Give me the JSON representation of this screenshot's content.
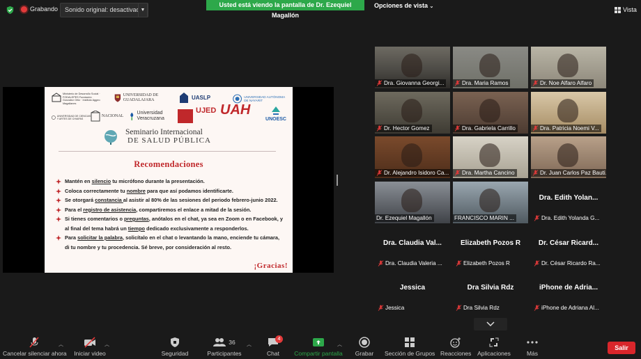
{
  "topbar": {
    "recording_label": "Grabando",
    "sound_option": "Sonido original: desactivado",
    "viewing_banner": "Usted está viendo la pantalla de Dr. Ezequiel Magallón",
    "view_options": "Opciones de vista",
    "view_label": "Vista"
  },
  "slide": {
    "logos": {
      "l1": "Ministerio de Desarrollo Social · FODALEPES Fundación Gonzalez Ortiz · Instituto Aggeo Magallanes",
      "l2": "UNIVERSIDAD DE GUADALAJARA",
      "l3": "UASLP",
      "l4": "UNIVERSIDAD AUTÓNOMA DE NAYARIT",
      "l5": "UNIVERSIDAD DE CIENCIAS Y ARTES DE CHIAPAS",
      "l6": "NACIONAL",
      "l7": "Universidad Veracruzana",
      "l8": "UJED",
      "l9": "UAH",
      "l10": "UNOESC"
    },
    "seminar_line1": "Seminario Internacional",
    "seminar_line2": "DE SALUD PÚBLICA",
    "heading": "Recomendaciones",
    "thanks": "¡Gracias!",
    "bullets": [
      {
        "a": "Mantén en ",
        "u": "silencio",
        "b": " tu micrófono durante la presentación."
      },
      {
        "a": "Coloca correctamente tu ",
        "u": "nombre",
        "b": " para que así podamos identificarte."
      },
      {
        "a": "Se otorgará ",
        "u": "constancia ",
        "b": "al asistir al 80% de las sesiones del periodo febrero-junio 2022."
      },
      {
        "a": "Para el ",
        "u": "registro de asistencia",
        "b": ", compartiremos el enlace a mitad de la sesión."
      },
      {
        "a": "Si tienes comentarios o ",
        "u": "preguntas",
        "b": ", anótalos en el chat, ya sea en Zoom o en Facebook, y al final del tema habrá un ",
        "u2": "tiempo",
        "c": " dedicado exclusivamente a responderlos."
      },
      {
        "a": "Para ",
        "u": "solicitar la palabra",
        "b": ", solicítalo en el chat o levantando la mano, enciende tu cámara, di tu nombre y tu procedencia. Sé breve, por consideración al resto."
      }
    ]
  },
  "participants": [
    {
      "name": "Dra. Giovanna Georgi..."
    },
    {
      "name": "Dra. Maria Ramos"
    },
    {
      "name": "Dr. Noe Alfaro Alfaro"
    },
    {
      "name": "Dr. Hector Gomez"
    },
    {
      "name": "Dra. Gabriela Carrillo"
    },
    {
      "name": "Dra. Patricia Noemi V..."
    },
    {
      "name": "Dr. Alejandro Isidoro Ca..."
    },
    {
      "name": "Dra. Martha Cancino"
    },
    {
      "name": "Dr. Juan Carlos Paz Bauti..."
    },
    {
      "name": "Dr. Ezequiel Magallón"
    },
    {
      "name": "FRANCISCO MARIN ..."
    },
    {
      "name": "Dra. Edith Yolanda G...",
      "big": "Dra. Edith Yolan..."
    },
    {
      "name": "Dra. Claudia Valeria ...",
      "big": "Dra. Claudia Val..."
    },
    {
      "name": "Elizabeth Pozos R",
      "big": "Elizabeth Pozos R"
    },
    {
      "name": "Dr. César Ricardo Ra...",
      "big": "Dr. César Ricard..."
    },
    {
      "name": "Jessica",
      "big": "Jessica"
    },
    {
      "name": "Dra Silvia Rdz",
      "big": "Dra Silvia Rdz"
    },
    {
      "name": "iPhone de Adriana Al...",
      "big": "iPhone de Adria..."
    }
  ],
  "toolbar": {
    "mute": "Cancelar silenciar ahora",
    "video": "Iniciar video",
    "security": "Seguridad",
    "participants": "Participantes",
    "participants_count": "36",
    "chat": "Chat",
    "chat_badge": "4",
    "share": "Compartir pantalla",
    "record": "Grabar",
    "breakout": "Sección de Grupos",
    "reactions": "Reacciones",
    "apps": "Aplicaciones",
    "more": "Más",
    "leave": "Salir"
  },
  "colors": {
    "banner_green": "#2da84a",
    "slide_red": "#c0282b",
    "leave_red": "#d9262b",
    "active_speaker": "#e4d64b"
  }
}
